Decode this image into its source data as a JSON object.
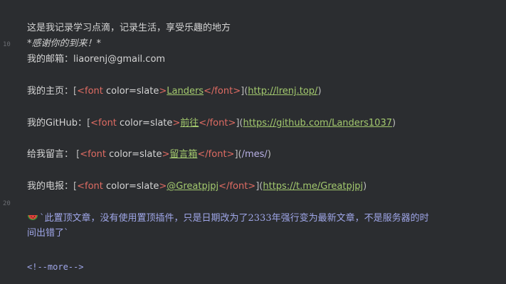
{
  "gutter": {
    "ln10": "10",
    "ln20": "20"
  },
  "lines": {
    "intro": "这是我记录学习点滴，记录生活，享受乐趣的地方",
    "thanks": "*感谢你的到来！*",
    "email_label": "我的邮箱：",
    "email_value": "liaorenj@gmail.com",
    "home_label": "我的主页：",
    "github_label": "我的GitHub：",
    "msg_label": "给我留言：",
    "tg_label": "我的电报："
  },
  "tokens": {
    "open_bracket": "[",
    "font_open": "<font",
    "attr": " color=slate",
    "gt": ">",
    "font_close": "</font>",
    "bracket_paren": "](",
    "close_paren": ")"
  },
  "links": {
    "home_text": "Landers",
    "home_url": "http://lrenj.top/",
    "github_text": "前往",
    "github_url": "https://github.com/Landers1037",
    "msg_text": "留言箱",
    "msg_url": "/mes/",
    "tg_text": "@Greatpjpj",
    "tg_url": "https://t.me/Greatpjpj"
  },
  "note": {
    "icon": "watermelon-icon",
    "line1": "`此置顶文章，没有使用置顶插件，只是日期改为了2333年强行变为最新文章，不是服务器的时",
    "line2": "间出错了`"
  },
  "more": "<!--more-->"
}
